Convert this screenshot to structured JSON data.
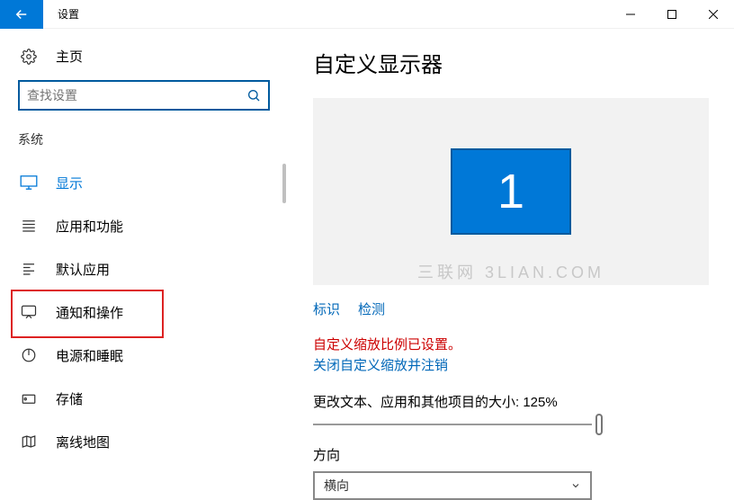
{
  "titlebar": {
    "title": "设置"
  },
  "sidebar": {
    "home_label": "主页",
    "search_placeholder": "查找设置",
    "section_label": "系统",
    "items": [
      {
        "label": "显示"
      },
      {
        "label": "应用和功能"
      },
      {
        "label": "默认应用"
      },
      {
        "label": "通知和操作"
      },
      {
        "label": "电源和睡眠"
      },
      {
        "label": "存储"
      },
      {
        "label": "离线地图"
      }
    ]
  },
  "main": {
    "page_title": "自定义显示器",
    "monitor_number": "1",
    "watermark": "三联网 3LIAN.COM",
    "identify_label": "标识",
    "detect_label": "检测",
    "custom_scale_set": "自定义缩放比例已设置。",
    "disable_scale_link": "关闭自定义缩放并注销",
    "scale_label": "更改文本、应用和其他项目的大小: 125%",
    "orientation_label": "方向",
    "orientation_value": "横向"
  }
}
